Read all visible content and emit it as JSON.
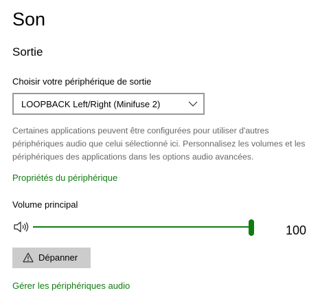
{
  "page": {
    "title": "Son"
  },
  "output": {
    "section_title": "Sortie",
    "device_label": "Choisir votre périphérique de sortie",
    "device_selected": "LOOPBACK Left/Right (Minifuse 2)",
    "description": "Certaines applications peuvent être configurées pour utiliser d'autres périphériques audio que celui sélectionné ici. Personnalisez les volumes et les périphériques des applications dans les options audio avancées.",
    "device_properties_link": "Propriétés du périphérique",
    "master_volume_label": "Volume principal",
    "volume": 100,
    "volume_max": 100,
    "volume_display": "100",
    "troubleshoot_label": "Dépanner",
    "manage_devices_link": "Gérer les périphériques audio"
  },
  "icons": {
    "speaker": "speaker-icon",
    "dropdown": "chevron-down-icon",
    "troubleshoot": "warning-icon"
  },
  "colors": {
    "accent": "#107c10",
    "description_text": "#666666",
    "button_background": "#cccccc",
    "dropdown_border": "#999999"
  }
}
